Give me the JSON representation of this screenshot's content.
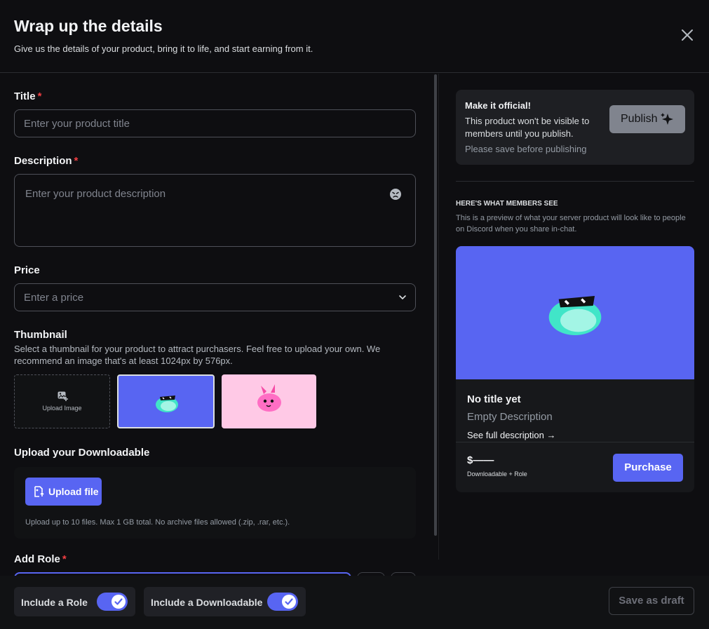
{
  "header": {
    "title": "Wrap up the details",
    "subtitle": "Give us the details of your product, bring it to life, and start earning from it."
  },
  "form": {
    "title_label": "Title",
    "title_placeholder": "Enter your product title",
    "description_label": "Description",
    "description_placeholder": "Enter your product description",
    "price_label": "Price",
    "price_placeholder": "Enter a price",
    "thumbnail_label": "Thumbnail",
    "thumbnail_help": "Select a thumbnail for your product to attract purchasers. Feel free to upload your own. We recommend an image that's at least 1024px by 576px.",
    "upload_image_label": "Upload Image",
    "downloadable_label": "Upload your Downloadable",
    "upload_file_label": "Upload file",
    "upload_help": "Upload up to 10 files. Max 1 GB total. No archive files allowed (.zip, .rar, etc.).",
    "role_label": "Add Role",
    "required_mark": "*"
  },
  "bottom": {
    "toggle_role": "Include a Role",
    "toggle_downloadable": "Include a Downloadable",
    "save_draft": "Save as draft"
  },
  "sidebar": {
    "official_title": "Make it official!",
    "official_text": "This product won't be visible to members until you publish.",
    "official_note": "Please save before publishing",
    "publish_label": "Publish",
    "preview_heading": "HERE'S WHAT MEMBERS SEE",
    "preview_text": "This is a preview of what your server product will look like to people on Discord when you share in-chat.",
    "product_title": "No title yet",
    "product_desc": "Empty Description",
    "full_desc_link": "See full description",
    "price": "$——",
    "includes": "Downloadable + Role",
    "purchase_label": "Purchase"
  },
  "colors": {
    "accent": "#5865f2",
    "danger": "#f23f43",
    "background": "#0e0e11",
    "thumb_pink": "#ffc9e6"
  }
}
